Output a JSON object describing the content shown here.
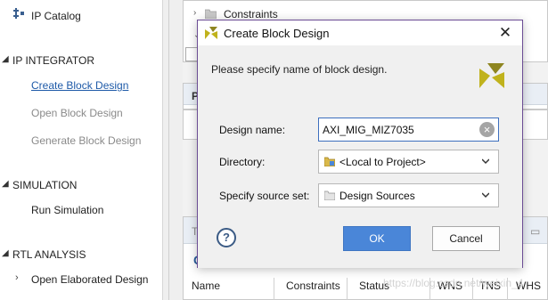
{
  "flow_navigator": {
    "ip_catalog": "IP Catalog",
    "ip_integrator": {
      "title": "IP INTEGRATOR",
      "items": [
        "Create Block Design",
        "Open Block Design",
        "Generate Block Design"
      ]
    },
    "simulation": {
      "title": "SIMULATION",
      "items": [
        "Run Simulation"
      ]
    },
    "rtl_analysis": {
      "title": "RTL ANALYSIS",
      "items": [
        "Open Elaborated Design"
      ]
    }
  },
  "background": {
    "sources_tree_item": "Constraints",
    "panel_letter_p": "P",
    "panel_letter_t": "T",
    "panel_letter_c": "C",
    "table_headers": [
      "Name",
      "Constraints",
      "Status",
      "WNS",
      "TNS",
      "WHS"
    ],
    "watermark": "https://blog.csdn.net/weixin_4"
  },
  "dialog": {
    "title": "Create Block Design",
    "instruction": "Please specify name of block design.",
    "design_name": {
      "label": "Design name:",
      "value": "AXI_MIG_MIZ7035"
    },
    "directory": {
      "label": "Directory:",
      "value": "<Local to Project>"
    },
    "source_set": {
      "label": "Specify source set:",
      "value": "Design Sources"
    },
    "ok_label": "OK",
    "cancel_label": "Cancel",
    "help_label": "?"
  },
  "colors": {
    "link": "#1e5aa8",
    "accent": "#4a86d8",
    "dialog_border": "#6b4c94",
    "logo": "#c0b21c"
  }
}
